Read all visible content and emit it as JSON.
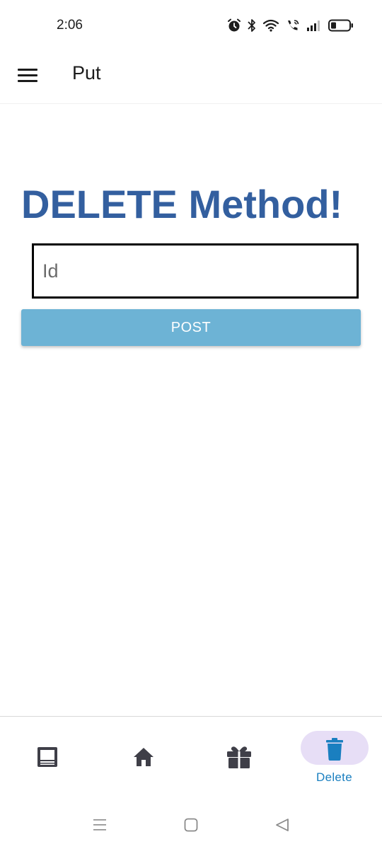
{
  "status_bar": {
    "time": "2:06",
    "icons": [
      "alarm-icon",
      "bluetooth-icon",
      "wifi-icon",
      "call-icon",
      "signal-icon",
      "battery-icon"
    ]
  },
  "app_bar": {
    "menu_icon": "menu-icon",
    "title": "Put"
  },
  "main": {
    "heading": "DELETE Method!",
    "id_input": {
      "value": "",
      "placeholder": "Id"
    },
    "post_button_label": "POST",
    "heading_color": "#335f9f",
    "button_color": "#6db3d5"
  },
  "bottom_nav": {
    "tabs": [
      {
        "icon": "laptop-icon",
        "label": "",
        "active": false
      },
      {
        "icon": "home-icon",
        "label": "",
        "active": false
      },
      {
        "icon": "gift-icon",
        "label": "",
        "active": false
      },
      {
        "icon": "trash-icon",
        "label": "Delete",
        "active": true
      }
    ],
    "active_color": "#1a7fc0",
    "active_pill_color": "#e7def6"
  },
  "system_nav": {
    "buttons": [
      "recents-icon",
      "home-square-icon",
      "back-triangle-icon"
    ]
  }
}
